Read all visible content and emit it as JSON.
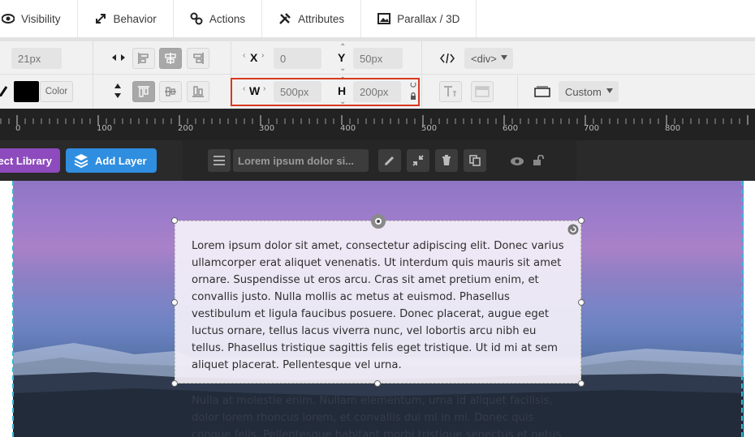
{
  "tabs": [
    {
      "label": "Visibility",
      "icon": "eye-icon"
    },
    {
      "label": "Behavior",
      "icon": "resize-icon"
    },
    {
      "label": "Actions",
      "icon": "link-icon"
    },
    {
      "label": "Attributes",
      "icon": "tools-icon"
    },
    {
      "label": "Parallax / 3D",
      "icon": "image-icon"
    }
  ],
  "toolbar": {
    "font_size_value": "21px",
    "color_label": "Color",
    "x_label": "X",
    "x_value": "0",
    "y_label": "Y",
    "y_value": "50px",
    "w_label": "W",
    "w_value": "500px",
    "h_label": "H",
    "h_value": "200px",
    "tag_select": "<div>",
    "size_select": "Custom"
  },
  "ruler": {
    "labels": [
      "0",
      "100",
      "200",
      "300",
      "400",
      "500",
      "600",
      "700",
      "800"
    ]
  },
  "layerbar": {
    "object_library_label": "ect Library",
    "add_layer_label": "Add Layer",
    "layer_name": "Lorem ipsum dolor si..."
  },
  "canvas": {
    "paragraph1": "Lorem ipsum dolor sit amet, consectetur adipiscing elit. Donec varius ullamcorper erat aliquet venenatis. Ut interdum quis mauris sit amet ornare. Suspendisse ut eros arcu. Cras sit amet pretium enim, et convallis justo. Nulla mollis ac metus at euismod. Phasellus vestibulum et ligula faucibus posuere. Donec placerat, augue eget luctus ornare, tellus lacus viverra nunc, vel lobortis arcu nibh eu tellus. Phasellus tristique sagittis felis eget tristique. Ut id mi at sem aliquet placerat. Pellentesque vel urna.",
    "paragraph2": "Nulla at molestie enim. Nullam elementum, urna id aliquet facilisis, dolor lorem rhoncus lorem, et convallis dui mi in mi. Donec quis congue felis. Pellentesque habitant morbi tristique senectus et netus"
  },
  "colors": {
    "highlight": "#d8391f",
    "object_library_bg": "#8e4bbd",
    "add_layer_bg": "#2f8ee0",
    "guide": "#35b8d8"
  }
}
